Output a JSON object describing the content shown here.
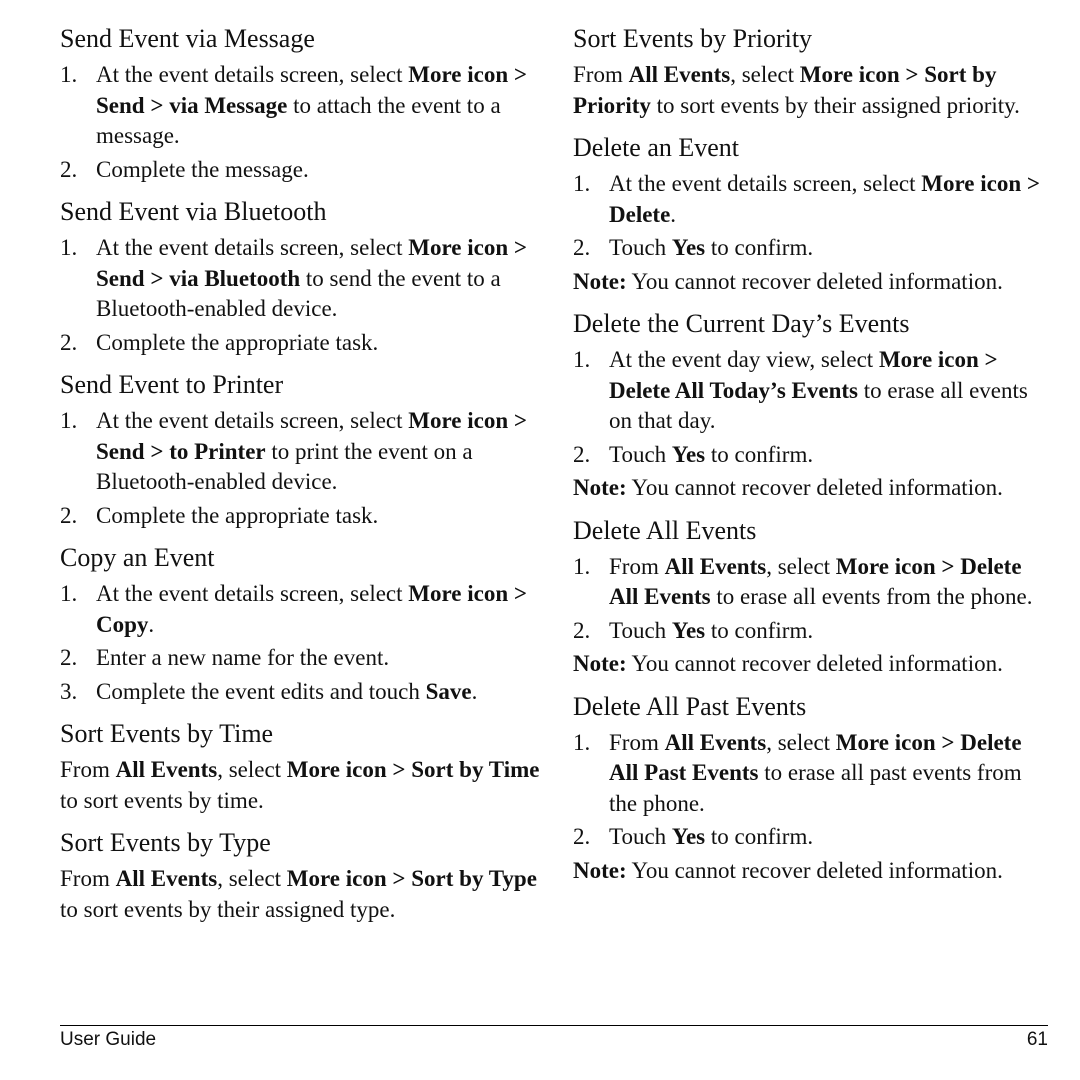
{
  "left": [
    {
      "title": "Send Event via Message",
      "type": "steps",
      "items": [
        [
          [
            "At the event details screen, select ",
            0
          ],
          [
            "More icon > Send > via Message",
            1
          ],
          [
            " to attach the event to a message.",
            0
          ]
        ],
        [
          [
            "Complete the message.",
            0
          ]
        ]
      ]
    },
    {
      "title": "Send Event via Bluetooth",
      "type": "steps",
      "items": [
        [
          [
            "At the event details screen, select ",
            0
          ],
          [
            "More icon > Send > via Bluetooth",
            1
          ],
          [
            " to send the event to a Bluetooth-enabled device.",
            0
          ]
        ],
        [
          [
            "Complete the appropriate task.",
            0
          ]
        ]
      ]
    },
    {
      "title": "Send Event to Printer",
      "type": "steps",
      "items": [
        [
          [
            "At the event details screen, select ",
            0
          ],
          [
            "More icon > Send > to Printer",
            1
          ],
          [
            " to print the event on a Bluetooth-enabled device.",
            0
          ]
        ],
        [
          [
            "Complete the appropriate task.",
            0
          ]
        ]
      ]
    },
    {
      "title": "Copy an Event",
      "type": "steps",
      "items": [
        [
          [
            "At the event details screen, select ",
            0
          ],
          [
            "More icon > Copy",
            1
          ],
          [
            ".",
            0
          ]
        ],
        [
          [
            "Enter a new name for the event.",
            0
          ]
        ],
        [
          [
            "Complete the event edits and touch ",
            0
          ],
          [
            "Save",
            1
          ],
          [
            ".",
            0
          ]
        ]
      ]
    },
    {
      "title": "Sort Events by Time",
      "type": "para",
      "items": [
        [
          [
            "From ",
            0
          ],
          [
            "All Events",
            1
          ],
          [
            ", select ",
            0
          ],
          [
            "More icon > Sort by Time",
            1
          ],
          [
            " to sort events by time.",
            0
          ]
        ]
      ]
    },
    {
      "title": "Sort Events by Type",
      "type": "para",
      "items": [
        [
          [
            "From ",
            0
          ],
          [
            "All Events",
            1
          ],
          [
            ", select ",
            0
          ],
          [
            "More icon > Sort by Type",
            1
          ],
          [
            " to sort events by their assigned type.",
            0
          ]
        ]
      ]
    }
  ],
  "right": [
    {
      "title": "Sort Events by Priority",
      "type": "para",
      "items": [
        [
          [
            "From ",
            0
          ],
          [
            "All Events",
            1
          ],
          [
            ", select ",
            0
          ],
          [
            "More icon > Sort by Priority",
            1
          ],
          [
            " to sort events by their assigned priority.",
            0
          ]
        ]
      ]
    },
    {
      "title": "Delete an Event",
      "type": "steps",
      "items": [
        [
          [
            "At the event details screen, select ",
            0
          ],
          [
            "More icon > Delete",
            1
          ],
          [
            ".",
            0
          ]
        ],
        [
          [
            "Touch ",
            0
          ],
          [
            "Yes",
            1
          ],
          [
            " to confirm.",
            0
          ]
        ]
      ],
      "note": [
        [
          "Note:",
          1
        ],
        [
          " You cannot recover deleted information.",
          0
        ]
      ]
    },
    {
      "title": "Delete the Current Day’s Events",
      "type": "steps",
      "items": [
        [
          [
            "At the event day view, select ",
            0
          ],
          [
            "More icon > Delete All Today’s Events",
            1
          ],
          [
            " to erase all events on that day.",
            0
          ]
        ],
        [
          [
            "Touch ",
            0
          ],
          [
            "Yes",
            1
          ],
          [
            " to confirm.",
            0
          ]
        ]
      ],
      "note": [
        [
          "Note:",
          1
        ],
        [
          " You cannot recover deleted information.",
          0
        ]
      ]
    },
    {
      "title": "Delete All Events",
      "type": "steps",
      "items": [
        [
          [
            "From ",
            0
          ],
          [
            "All Events",
            1
          ],
          [
            ", select ",
            0
          ],
          [
            "More icon > Delete All Events",
            1
          ],
          [
            " to erase all events from the phone.",
            0
          ]
        ],
        [
          [
            "Touch ",
            0
          ],
          [
            "Yes",
            1
          ],
          [
            " to confirm.",
            0
          ]
        ]
      ],
      "note": [
        [
          "Note:",
          1
        ],
        [
          " You cannot recover deleted information.",
          0
        ]
      ]
    },
    {
      "title": "Delete All Past Events",
      "type": "steps",
      "items": [
        [
          [
            "From ",
            0
          ],
          [
            "All Events",
            1
          ],
          [
            ", select ",
            0
          ],
          [
            "More icon > Delete All Past Events",
            1
          ],
          [
            " to erase all past events from the phone.",
            0
          ]
        ],
        [
          [
            "Touch ",
            0
          ],
          [
            "Yes",
            1
          ],
          [
            " to confirm.",
            0
          ]
        ]
      ],
      "note": [
        [
          "Note:",
          1
        ],
        [
          " You cannot recover deleted information.",
          0
        ]
      ]
    }
  ],
  "footer": {
    "left": "User Guide",
    "page": "61"
  }
}
